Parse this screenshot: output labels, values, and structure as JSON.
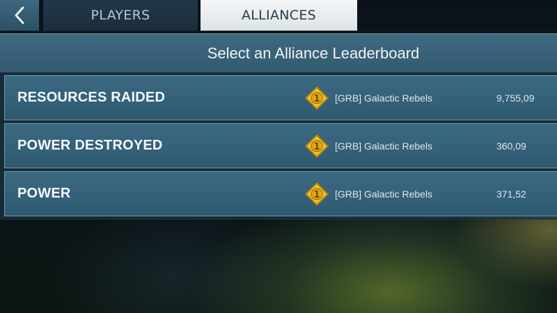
{
  "tabs": {
    "back_icon": "chevron-left-icon",
    "players_label": "PLAYERS",
    "alliances_label": "ALLIANCES",
    "active": "ALLIANCES"
  },
  "header": {
    "title": "Select an Alliance Leaderboard"
  },
  "leaderboards": [
    {
      "label": "RESOURCES RAIDED",
      "rank": "1",
      "alliance": "[GRB] Galactic Rebels",
      "value": "9,755,09"
    },
    {
      "label": "POWER DESTROYED",
      "rank": "1",
      "alliance": "[GRB] Galactic Rebels",
      "value": "360,09"
    },
    {
      "label": "POWER",
      "rank": "1",
      "alliance": "[GRB] Galactic Rebels",
      "value": "371,52"
    }
  ],
  "colors": {
    "accent_gold": "#e6b020",
    "row_bg": "#35617a",
    "active_tab_bg": "#eef1f3"
  }
}
